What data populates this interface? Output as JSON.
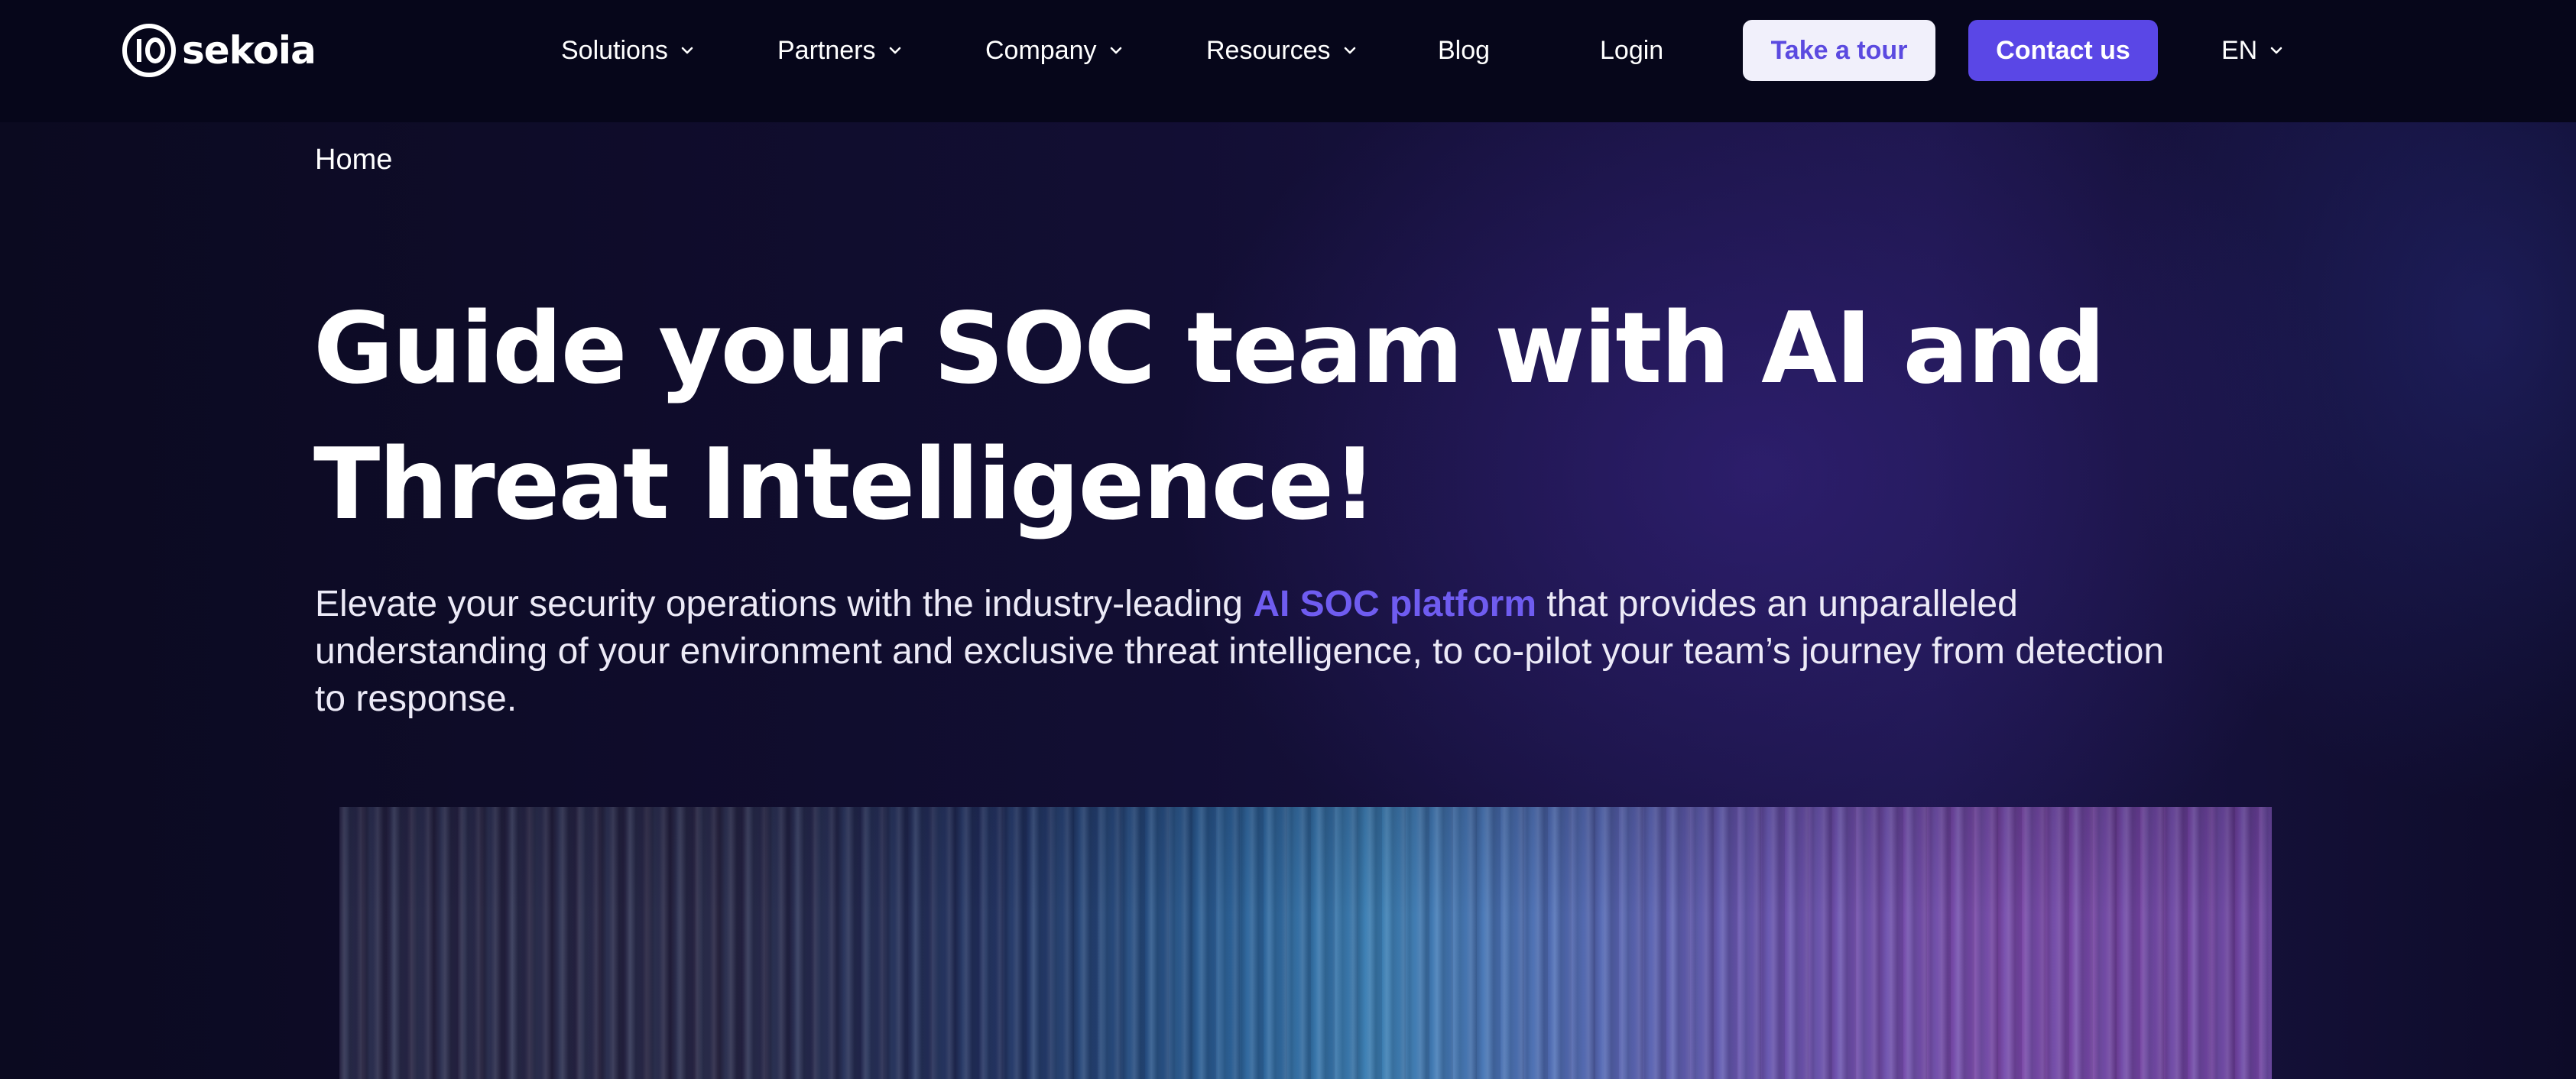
{
  "brand": {
    "name": "sekoia",
    "logo_icon": "io-ring-logo"
  },
  "nav": {
    "items": [
      {
        "label": "Solutions",
        "has_dropdown": true
      },
      {
        "label": "Partners",
        "has_dropdown": true
      },
      {
        "label": "Company",
        "has_dropdown": true
      },
      {
        "label": "Resources",
        "has_dropdown": true
      },
      {
        "label": "Blog",
        "has_dropdown": false
      },
      {
        "label": "Login",
        "has_dropdown": false
      }
    ],
    "take_tour_label": "Take a tour",
    "contact_label": "Contact us",
    "language": "EN"
  },
  "breadcrumb": {
    "home": "Home"
  },
  "hero": {
    "title_line1": "Guide your SOC team with AI and",
    "title_line2": "Threat Intelligence!",
    "subtitle_before": "Elevate your security operations with the industry-leading ",
    "subtitle_link": "AI SOC platform",
    "subtitle_after": " that provides an unparalleled understanding of your environment and exclusive threat intelligence, to co-pilot your team’s journey from detection to response."
  },
  "colors": {
    "accent": "#5a47e6",
    "accent_text": "#6f5cf0",
    "header_bg": "#06061a",
    "page_bg": "#0c0a22"
  }
}
